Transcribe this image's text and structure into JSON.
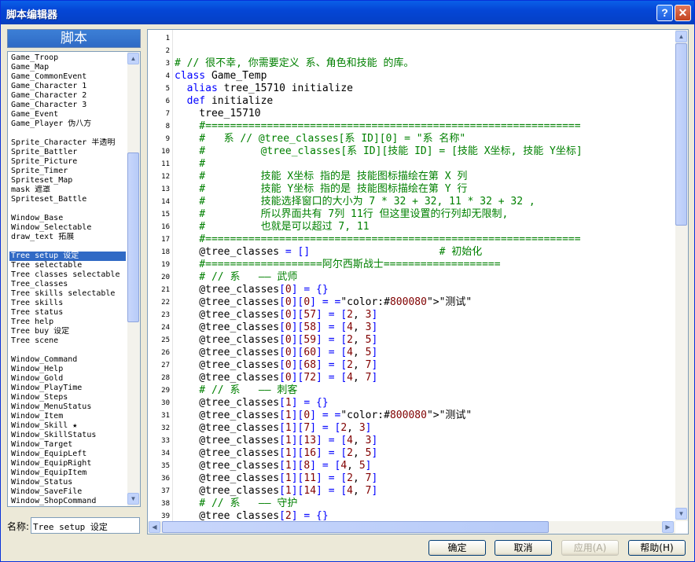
{
  "window": {
    "title": "脚本编辑器",
    "help_btn": "?",
    "close_btn": "✕"
  },
  "left": {
    "header": "脚本",
    "scripts": [
      "Game_Troop",
      "Game_Map",
      "Game_CommonEvent",
      "Game_Character 1",
      "Game_Character 2",
      "Game_Character 3",
      "Game_Event",
      "Game_Player 伪八方",
      "",
      "Sprite_Character 半透明",
      "Sprite_Battler",
      "Sprite_Picture",
      "Sprite_Timer",
      "Spriteset_Map",
      "mask 遮罩",
      "Spriteset_Battle",
      "",
      "Window_Base",
      "Window_Selectable",
      "draw_text 拓展",
      "",
      "Tree setup 设定",
      "Tree selectable",
      "Tree classes selectable",
      "Tree_classes",
      "Tree skills selectable",
      "Tree skills",
      "Tree status",
      "Tree help",
      "Tree buy 设定",
      "Tree scene",
      "",
      "Window_Command",
      "Window_Help",
      "Window_Gold",
      "Window_PlayTime",
      "Window_Steps",
      "Window_MenuStatus",
      "Window_Item",
      "Window_Skill ★",
      "Window_SkillStatus",
      "Window_Target",
      "Window_EquipLeft",
      "Window_EquipRight",
      "Window_EquipItem",
      "Window_Status",
      "Window_SaveFile",
      "Window_ShopCommand"
    ],
    "selected_index": 21,
    "name_label": "名称:",
    "name_value": "Tree setup 设定"
  },
  "editor": {
    "lines": [
      {
        "n": "1",
        "t": "",
        "c": "#000000"
      },
      {
        "n": "2",
        "t": "",
        "c": "#000000"
      },
      {
        "n": "3",
        "t": "# // 很不幸, 你需要定义 系、角色和技能 的库。",
        "c": "#008000"
      },
      {
        "n": "4",
        "t": "class Game_Temp",
        "c": "#000000"
      },
      {
        "n": "5",
        "t": "  alias tree_15710 initialize",
        "c": "#000000"
      },
      {
        "n": "6",
        "t": "  def initialize",
        "c": "#000000"
      },
      {
        "n": "7",
        "t": "    tree_15710",
        "c": "#000000"
      },
      {
        "n": "8",
        "t": "    #=============================================================",
        "c": "#008000"
      },
      {
        "n": "9",
        "t": "    #   系 // @tree_classes[系 ID][0] = \"系 名称\"",
        "c": "#008000"
      },
      {
        "n": "10",
        "t": "    #         @tree_classes[系 ID][技能 ID] = [技能 X坐标, 技能 Y坐标]",
        "c": "#008000"
      },
      {
        "n": "11",
        "t": "    #",
        "c": "#008000"
      },
      {
        "n": "12",
        "t": "    #         技能 X坐标 指的是 技能图标描绘在第 X 列",
        "c": "#008000"
      },
      {
        "n": "13",
        "t": "    #         技能 Y坐标 指的是 技能图标描绘在第 Y 行",
        "c": "#008000"
      },
      {
        "n": "14",
        "t": "    #         技能选择窗口的大小为 7 * 32 + 32, 11 * 32 + 32 ,",
        "c": "#008000"
      },
      {
        "n": "15",
        "t": "    #         所以界面共有 7列 11行 但这里设置的行列却无限制,",
        "c": "#008000"
      },
      {
        "n": "16",
        "t": "    #         也就是可以超过 7, 11",
        "c": "#008000"
      },
      {
        "n": "17",
        "t": "    #=============================================================",
        "c": "#008000"
      },
      {
        "n": "18",
        "t": "    @tree_classes = []                     # 初始化",
        "c": "#000000"
      },
      {
        "n": "19",
        "t": "    #===================阿尔西斯战士===================",
        "c": "#008000"
      },
      {
        "n": "20",
        "t": "    # // 系   —— 武师",
        "c": "#008000"
      },
      {
        "n": "21",
        "t": "    @tree_classes[0] = {}",
        "c": "#000000"
      },
      {
        "n": "22",
        "t": "    @tree_classes[0][0] = \"测试\"",
        "c": "#000000"
      },
      {
        "n": "23",
        "t": "    @tree_classes[0][57] = [2, 3]",
        "c": "#000000"
      },
      {
        "n": "24",
        "t": "    @tree_classes[0][58] = [4, 3]",
        "c": "#000000"
      },
      {
        "n": "25",
        "t": "    @tree_classes[0][59] = [2, 5]",
        "c": "#000000"
      },
      {
        "n": "26",
        "t": "    @tree_classes[0][60] = [4, 5]",
        "c": "#000000"
      },
      {
        "n": "27",
        "t": "    @tree_classes[0][68] = [2, 7]",
        "c": "#000000"
      },
      {
        "n": "28",
        "t": "    @tree_classes[0][72] = [4, 7]",
        "c": "#000000"
      },
      {
        "n": "29",
        "t": "    # // 系   —— 刺客",
        "c": "#008000"
      },
      {
        "n": "30",
        "t": "    @tree_classes[1] = {}",
        "c": "#000000"
      },
      {
        "n": "31",
        "t": "    @tree_classes[1][0] = \"测试\"",
        "c": "#000000"
      },
      {
        "n": "32",
        "t": "    @tree_classes[1][7] = [2, 3]",
        "c": "#000000"
      },
      {
        "n": "33",
        "t": "    @tree_classes[1][13] = [4, 3]",
        "c": "#000000"
      },
      {
        "n": "34",
        "t": "    @tree_classes[1][16] = [2, 5]",
        "c": "#000000"
      },
      {
        "n": "35",
        "t": "    @tree_classes[1][8] = [4, 5]",
        "c": "#000000"
      },
      {
        "n": "36",
        "t": "    @tree_classes[1][11] = [2, 7]",
        "c": "#000000"
      },
      {
        "n": "37",
        "t": "    @tree_classes[1][14] = [4, 7]",
        "c": "#000000"
      },
      {
        "n": "38",
        "t": "    # // 系   —— 守护",
        "c": "#008000"
      },
      {
        "n": "39",
        "t": "    @tree_classes[2] = {}",
        "c": "#000000"
      }
    ]
  },
  "buttons": {
    "ok": "确定",
    "cancel": "取消",
    "apply": "应用(A)",
    "help": "帮助(H)"
  },
  "colors": {
    "keyword": "#0000ff",
    "comment": "#008000",
    "string": "#800080",
    "selection": "#316ac5"
  }
}
